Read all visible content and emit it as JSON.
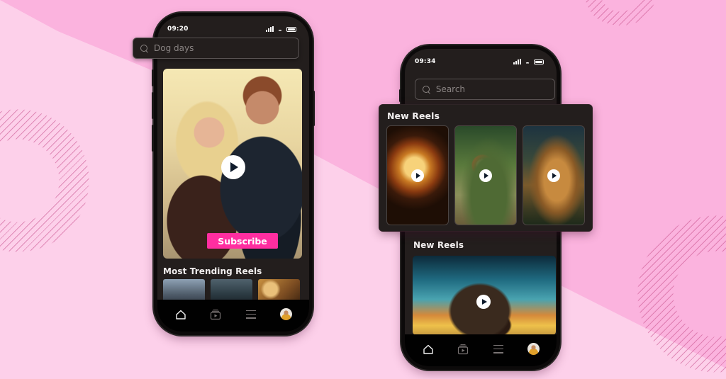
{
  "theme": {
    "background_pink": "#fbb3de",
    "background_light_pink": "#fdd0ea",
    "screen_bg": "#231e1d",
    "accent": "#ff2ea0"
  },
  "phone_left": {
    "status": {
      "time": "09:20",
      "icons": [
        "signal-icon",
        "wifi-icon",
        "battery-icon"
      ]
    },
    "search": {
      "value": "Dog days",
      "placeholder": "Search",
      "icon": "search-icon"
    },
    "hero": {
      "play_icon": "play-icon",
      "subscribe_label": "Subscribe"
    },
    "trending": {
      "title": "Most Trending Reels",
      "thumbnails": [
        "trending-reel-1",
        "trending-reel-2",
        "trending-reel-3"
      ]
    },
    "navbar": {
      "items": [
        {
          "name": "home",
          "icon": "home-icon"
        },
        {
          "name": "reels",
          "icon": "reels-icon"
        },
        {
          "name": "menu",
          "icon": "menu-icon"
        },
        {
          "name": "profile",
          "icon": "avatar"
        }
      ]
    }
  },
  "phone_right": {
    "status": {
      "time": "09:34",
      "icons": [
        "signal-icon",
        "wifi-icon",
        "battery-icon"
      ]
    },
    "search": {
      "value": "",
      "placeholder": "Search",
      "icon": "search-icon"
    },
    "popup_panel": {
      "title": "New Reels",
      "reels": [
        "new-reel-1",
        "new-reel-2",
        "new-reel-3"
      ]
    },
    "new_reels": {
      "title": "New Reels",
      "feature": "featured-reel"
    },
    "navbar": {
      "items": [
        {
          "name": "home",
          "icon": "home-icon"
        },
        {
          "name": "reels",
          "icon": "reels-icon"
        },
        {
          "name": "menu",
          "icon": "menu-icon"
        },
        {
          "name": "profile",
          "icon": "avatar"
        }
      ]
    }
  }
}
